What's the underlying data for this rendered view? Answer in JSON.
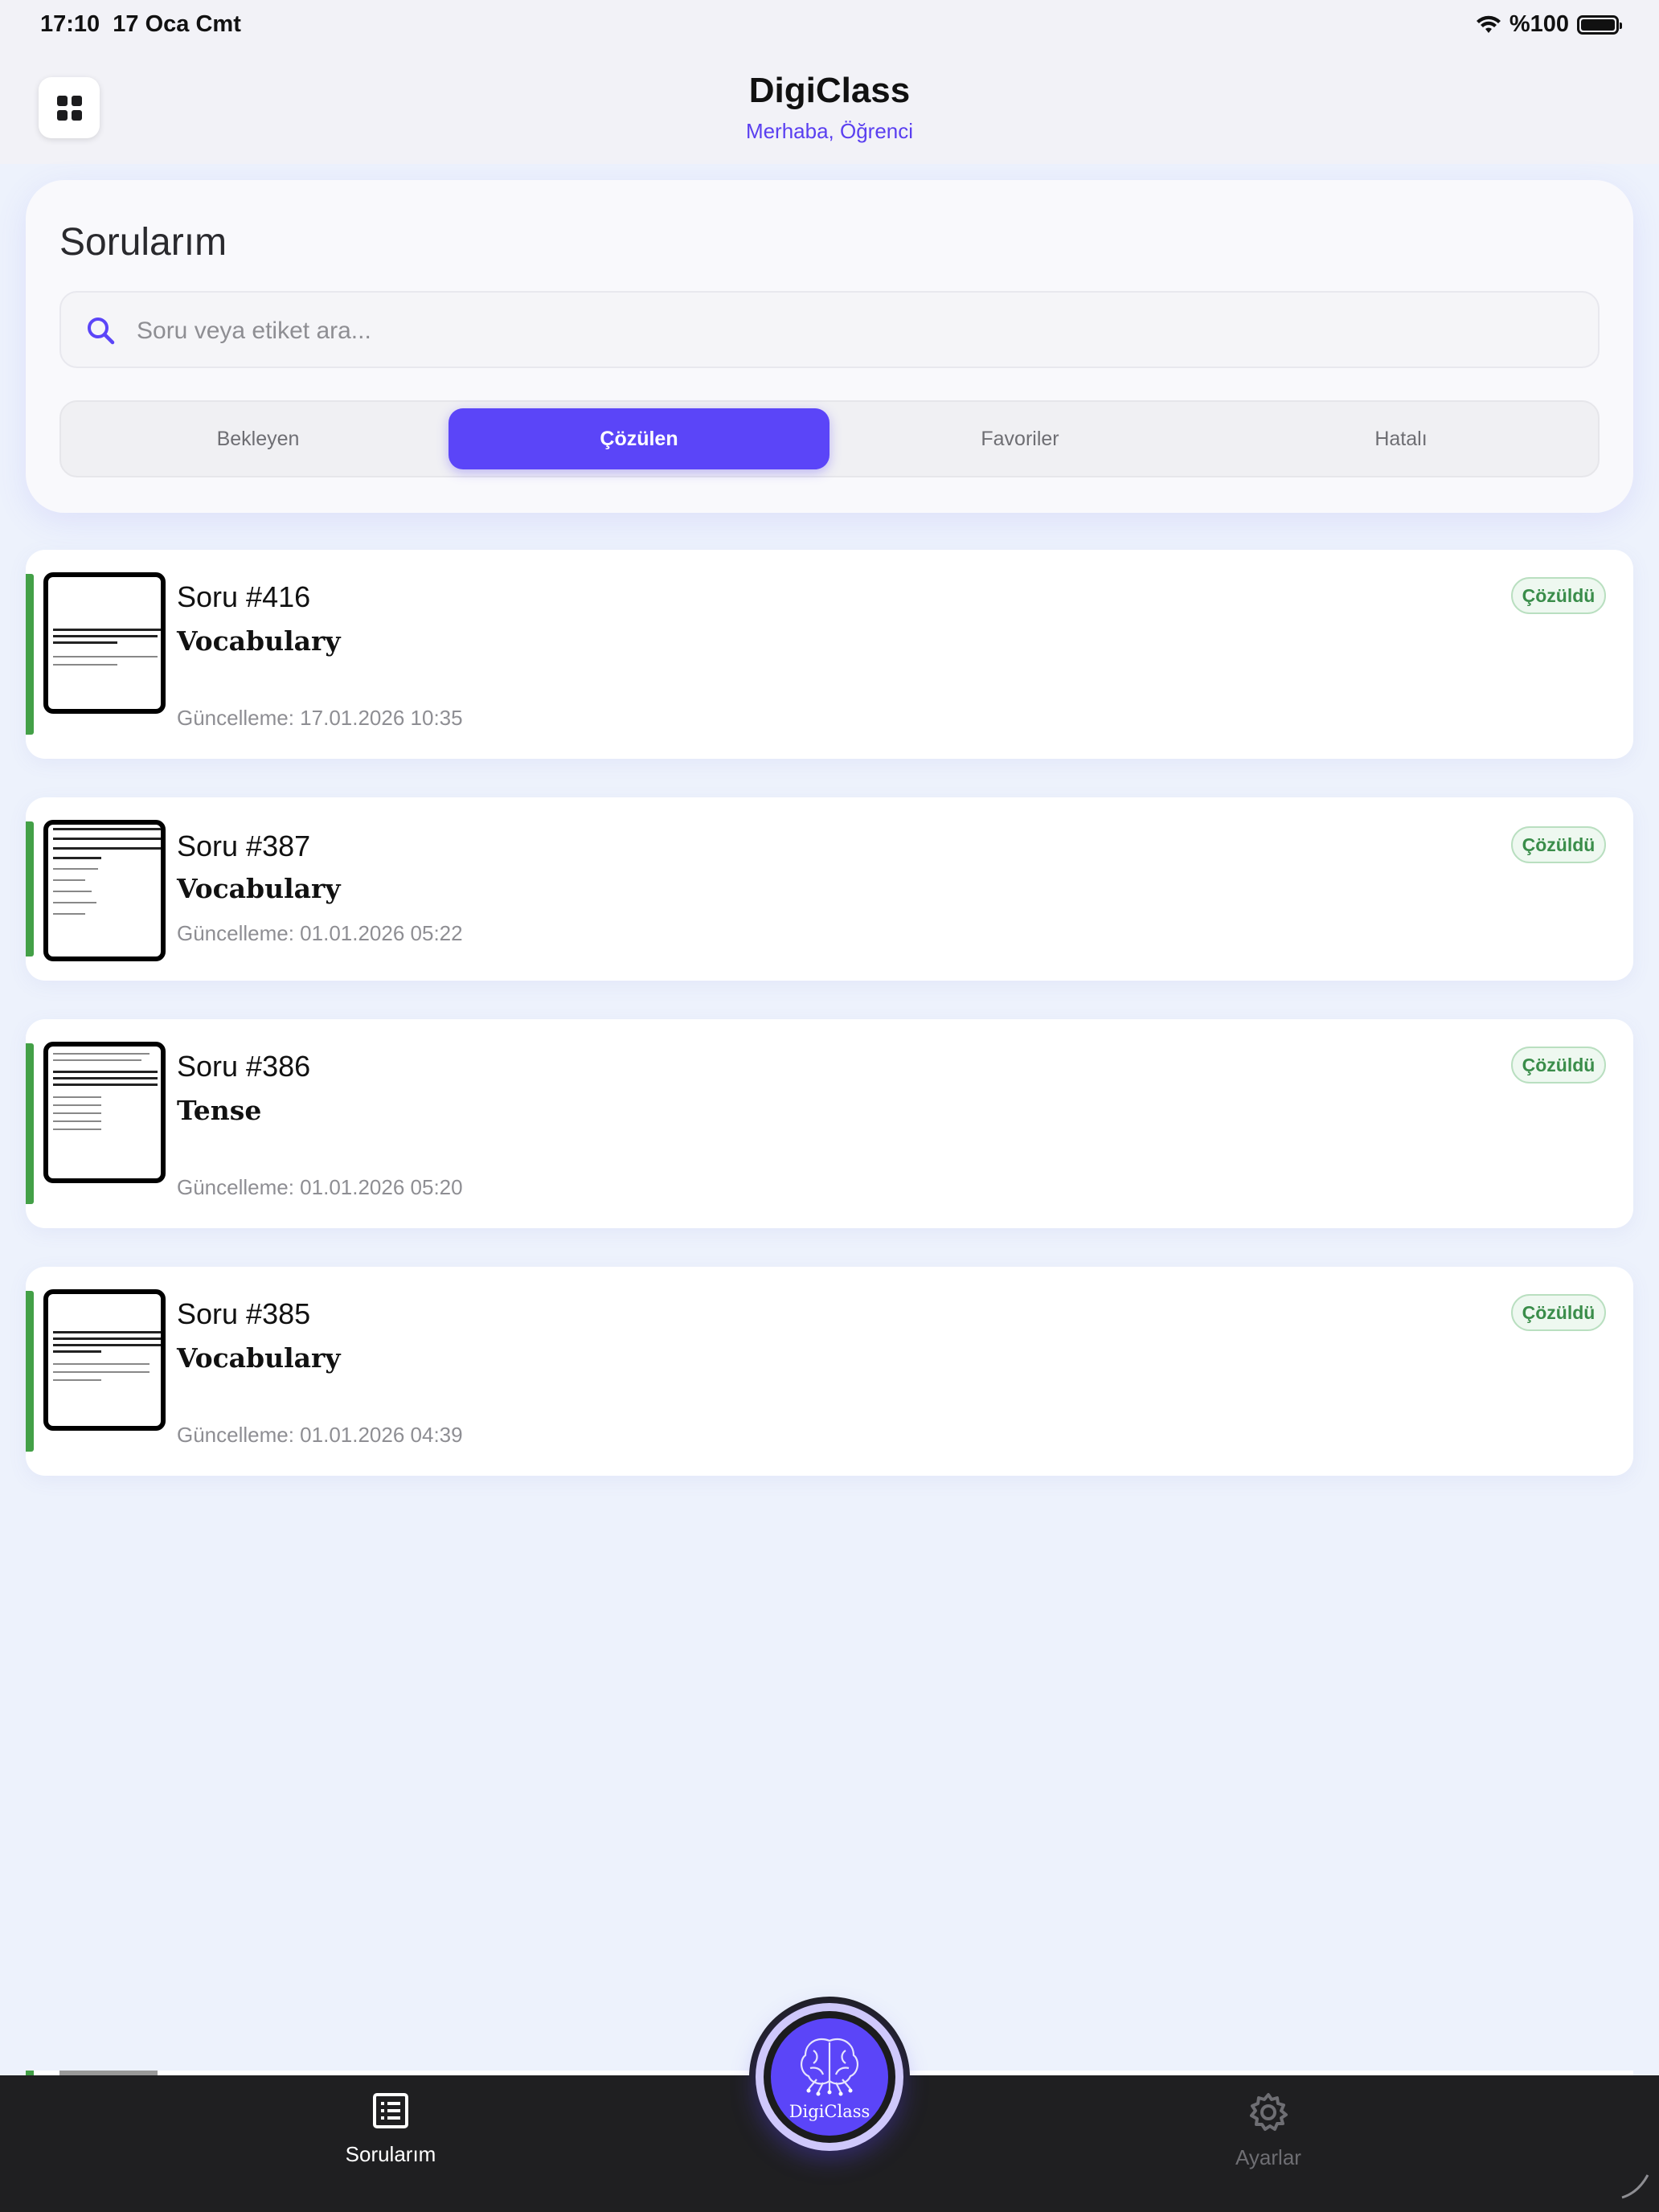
{
  "status_bar": {
    "time": "17:10",
    "date": "17 Oca Cmt",
    "battery": "%100"
  },
  "header": {
    "title": "DigiClass",
    "subtitle": "Merhaba, Öğrenci",
    "menu_icon": "grid-icon"
  },
  "page": {
    "title": "Sorularım",
    "search": {
      "placeholder": "Soru veya etiket ara...",
      "value": ""
    },
    "tabs": [
      {
        "label": "Bekleyen",
        "active": false
      },
      {
        "label": "Çözülen",
        "active": true
      },
      {
        "label": "Favoriler",
        "active": false
      },
      {
        "label": "Hatalı",
        "active": false
      }
    ]
  },
  "questions": [
    {
      "number": "Soru #416",
      "tag": "Vocabulary",
      "updated": "Güncelleme: 17.01.2026 10:35",
      "status": "Çözüldü"
    },
    {
      "number": "Soru #387",
      "tag": "Vocabulary",
      "updated": "Güncelleme: 01.01.2026 05:22",
      "status": "Çözüldü"
    },
    {
      "number": "Soru #386",
      "tag": "Tense",
      "updated": "Güncelleme: 01.01.2026 05:20",
      "status": "Çözüldü"
    },
    {
      "number": "Soru #385",
      "tag": "Vocabulary",
      "updated": "Güncelleme: 01.01.2026 04:39",
      "status": "Çözüldü"
    }
  ],
  "bottom_nav": {
    "left": {
      "label": "Sorularım",
      "icon": "list-icon",
      "active": true
    },
    "center": {
      "label": "DigiClass",
      "icon": "brain-logo-icon"
    },
    "right": {
      "label": "Ayarlar",
      "icon": "gear-icon",
      "active": false
    }
  },
  "colors": {
    "accent": "#5b45f8",
    "solved": "#43a047",
    "background": "#edf2fc"
  }
}
